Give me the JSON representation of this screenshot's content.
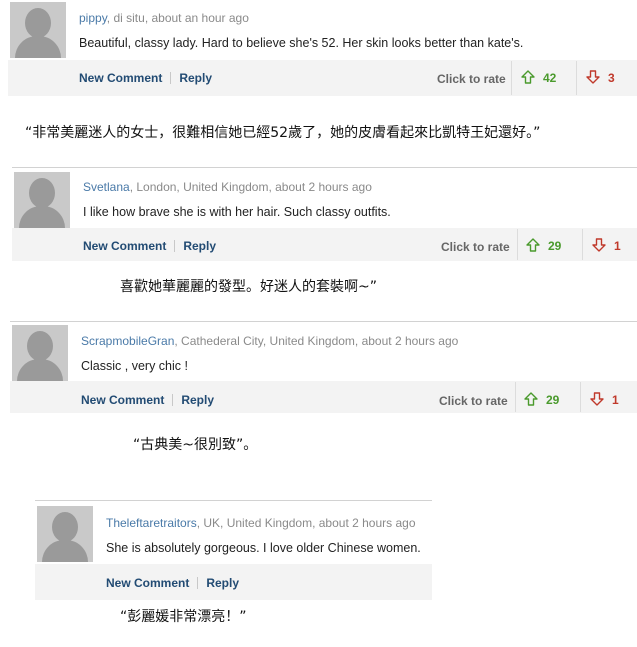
{
  "comments": [
    {
      "user": "pippy",
      "location": ", di situ, about an hour ago",
      "text": "Beautiful, classy lady. Hard to believe she's 52. Her skin looks better than kate's.",
      "new_comment": "New Comment",
      "reply": "Reply",
      "rate_label": "Click to rate",
      "up": "42",
      "down": "3"
    },
    {
      "user": "Svetlana",
      "location": ", London, United Kingdom, about 2 hours ago",
      "text": "I like how brave she is with her hair. Such classy outfits.",
      "new_comment": "New Comment",
      "reply": "Reply",
      "rate_label": "Click to rate",
      "up": "29",
      "down": "1"
    },
    {
      "user": "ScrapmobileGran",
      "location": ", Cathederal City, United Kingdom, about 2 hours ago",
      "text": "Classic , very chic !",
      "new_comment": "New Comment",
      "reply": "Reply",
      "rate_label": "Click to rate",
      "up": "29",
      "down": "1"
    },
    {
      "user": "Theleftaretraitors",
      "location": ", UK, United Kingdom, about 2 hours ago",
      "text": "She is absolutely gorgeous. I love older Chinese women.",
      "new_comment": "New Comment",
      "reply": "Reply"
    }
  ],
  "translations": [
    "“非常美麗迷人的女士，很難相信她已經52歲了，她的皮膚看起來比凱特王妃還好。”",
    "喜歡她華麗麗的發型。好迷人的套裝啊~”",
    "“古典美~很別致”。",
    "“彭麗媛非常漂亮！”"
  ],
  "colors": {
    "up": "#4a9a2c",
    "down": "#c0392b",
    "link": "#224b73",
    "username": "#4a7aa8"
  },
  "icons": {
    "up": "arrow-up-outline-icon",
    "down": "arrow-down-outline-icon",
    "avatar": "default-avatar-icon"
  }
}
